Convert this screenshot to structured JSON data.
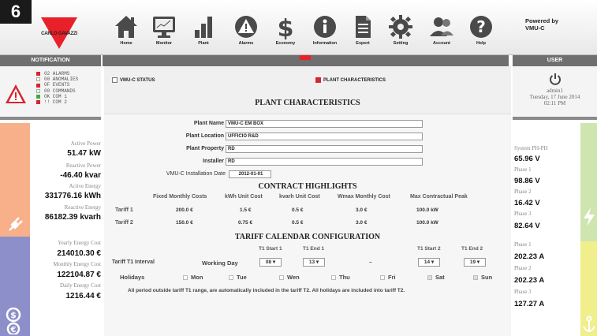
{
  "badge": "6",
  "brand": "CARLO GAVAZZI",
  "powered_by": "Powered by\nVMU-C",
  "nav": [
    "Home",
    "Monitor",
    "Plant",
    "Alarms",
    "Economy",
    "Information",
    "Export",
    "Setting",
    "Account",
    "Help"
  ],
  "headers": {
    "notification": "NOTIFICATION",
    "user": "USER"
  },
  "notifications": [
    {
      "status": "red",
      "text": "02  ALARMS"
    },
    {
      "status": "off",
      "text": "00  ANOMALIES"
    },
    {
      "status": "red",
      "text": "OF  EVENTS"
    },
    {
      "status": "off",
      "text": "00  COMMANDS"
    },
    {
      "status": "grn",
      "text": "OK  COM 1"
    },
    {
      "status": "red",
      "text": "!!  COM 2"
    }
  ],
  "user": {
    "name": "admin1",
    "date": "Tuesday, 17 June 2014",
    "time": "02:11 PM"
  },
  "left_values": [
    {
      "label": "Active Power",
      "value": "51.47 kW"
    },
    {
      "label": "Reactive Power",
      "value": "-46.40 kvar"
    },
    {
      "label": "Active Energy",
      "value": "331776.16 kWh"
    },
    {
      "label": "Reactive Energy",
      "value": "86182.39 kvarh"
    },
    {
      "label": "Yearly Energy Cost",
      "value": "214010.30 €"
    },
    {
      "label": "Monthly Energy Cost",
      "value": "122104.87 €"
    },
    {
      "label": "Daily Energy Cost",
      "value": "1216.44 €"
    }
  ],
  "checks": {
    "status": "VMU-C STATUS",
    "plant": "PLANT CHARACTERISTICS"
  },
  "plant": {
    "title": "PLANT CHARACTERISTICS",
    "name_label": "Plant Name",
    "name": "VMU-C EM BOX",
    "location_label": "Plant Location",
    "location": "UFFICIO R&D",
    "property_label": "Plant Property",
    "property": "RD",
    "installer_label": "Installer",
    "installer": "RD",
    "date_label": "VMU-C Installation Date",
    "date": "2012-01-01"
  },
  "contract": {
    "title": "CONTRACT HIGHLIGHTS",
    "headers": [
      "Fixed Monthly Costs",
      "kWh Unit Cost",
      "kvarh Unit Cost",
      "Wmax Monthly Cost",
      "Max Contractual Peak"
    ],
    "rows": [
      {
        "name": "Tariff  1",
        "values": [
          "200.0 €",
          "1.5 €",
          "0.5 €",
          "3.0 €",
          "100.0 kW"
        ]
      },
      {
        "name": "Tariff  2",
        "values": [
          "150.0 €",
          "0.75 €",
          "0.5 €",
          "3.0 €",
          "100.0 kW"
        ]
      }
    ]
  },
  "tariff": {
    "title": "TARIFF CALENDAR CONFIGURATION",
    "col_headers": [
      "T1 Start 1",
      "T1 End 1",
      "T1 Start 2",
      "T1 End 2"
    ],
    "interval_label": "Tariff T1 Interval",
    "day_type": "Working Day",
    "selects": [
      "08",
      "13",
      "14",
      "19"
    ],
    "dash": "–",
    "holidays_label": "Holidays",
    "days": [
      {
        "name": "Mon",
        "checked": false
      },
      {
        "name": "Tue",
        "checked": false
      },
      {
        "name": "Wen",
        "checked": false
      },
      {
        "name": "Thu",
        "checked": false
      },
      {
        "name": "Fri",
        "checked": false
      },
      {
        "name": "Sat",
        "checked": true
      },
      {
        "name": "Sun",
        "checked": true
      }
    ],
    "note": "All period outside tariff T1 range, are automatically included in the tariff T2. All holidays are included into tariff T2."
  },
  "right_values": [
    {
      "label": "System PH-PH",
      "value": "65.96 V"
    },
    {
      "label": "Phase 1",
      "value": "98.86 V"
    },
    {
      "label": "Phase 2",
      "value": "16.42 V"
    },
    {
      "label": "Phase 3",
      "value": "82.64 V"
    },
    {
      "label": "Phase 1",
      "value": "202.23 A"
    },
    {
      "label": "Phase 2",
      "value": "202.23 A"
    },
    {
      "label": "Phase 3",
      "value": "127.27 A"
    }
  ],
  "colors": {
    "accent": "#e8202a",
    "header": "#6f6f6f",
    "energy_bar": "#f7b08a",
    "cost_bar": "#8c8fc9",
    "voltage_bar": "#cfe5b0",
    "current_bar": "#f1ee8c"
  }
}
